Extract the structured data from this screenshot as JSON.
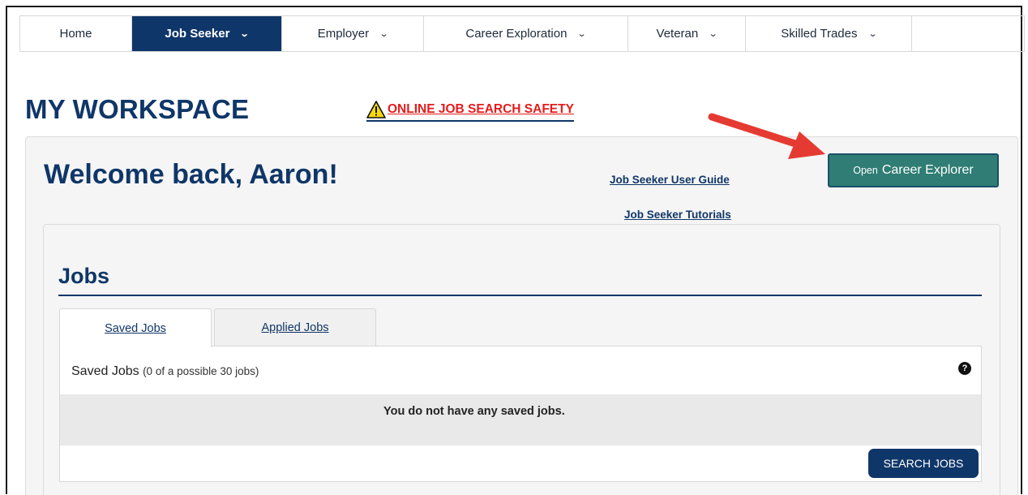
{
  "nav": {
    "items": [
      {
        "label": "Home",
        "dropdown": false,
        "active": false
      },
      {
        "label": "Job Seeker",
        "dropdown": true,
        "active": true
      },
      {
        "label": "Employer",
        "dropdown": true,
        "active": false
      },
      {
        "label": "Career Exploration",
        "dropdown": true,
        "active": false
      },
      {
        "label": "Veteran",
        "dropdown": true,
        "active": false
      },
      {
        "label": "Skilled Trades",
        "dropdown": true,
        "active": false
      }
    ]
  },
  "header": {
    "title": "MY WORKSPACE",
    "safety_link": "ONLINE JOB SEARCH SAFETY",
    "safety_icon": "warning-triangle-icon"
  },
  "welcome": {
    "greeting": "Welcome back, Aaron!",
    "user_guide_link": "Job Seeker User Guide",
    "tutorials_link": "Job Seeker Tutorials",
    "open_button_small": "Open",
    "open_button_big": "Career Explorer"
  },
  "jobs": {
    "title": "Jobs",
    "tabs": [
      "Saved Jobs",
      "Applied Jobs"
    ],
    "card_title": "Saved Jobs",
    "card_subtitle": "(0 of a possible 30 jobs)",
    "empty_message": "You do not have any saved jobs.",
    "search_button": "SEARCH JOBS",
    "help_icon": "question-circle-icon"
  },
  "colors": {
    "brand_navy": "#0f3668",
    "button_teal": "#2f7d74",
    "warning_red": "#e51c1c",
    "arrow_red": "#e53a32"
  }
}
